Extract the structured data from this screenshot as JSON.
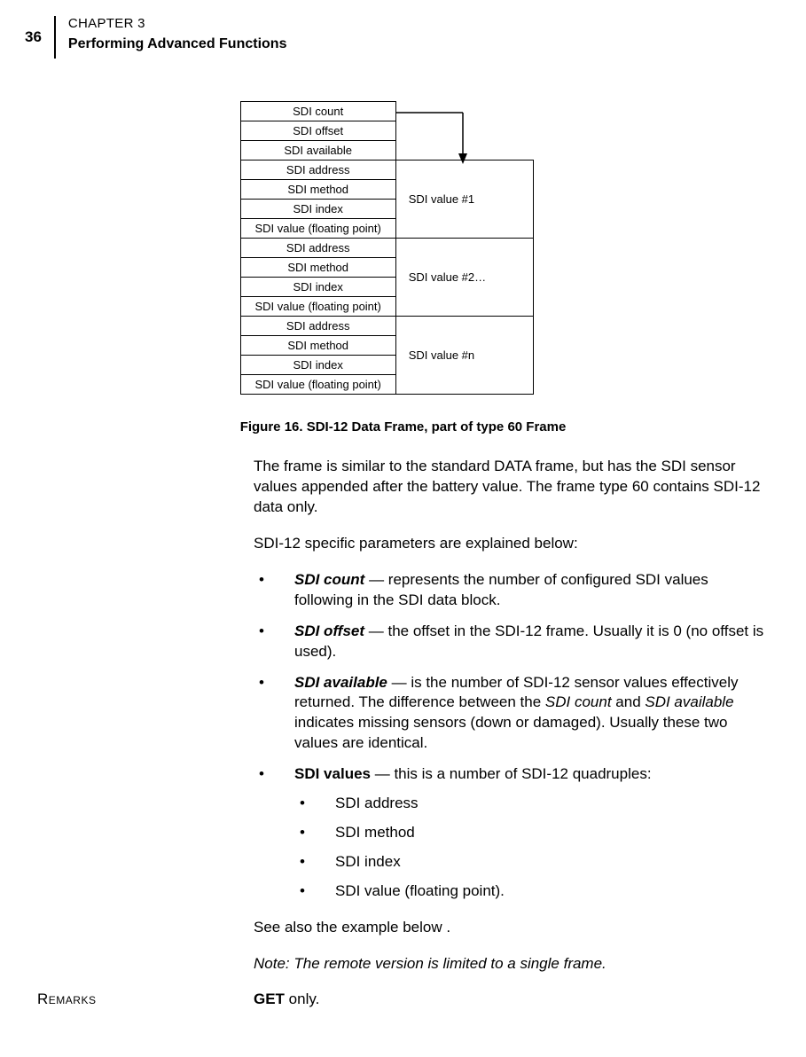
{
  "header": {
    "page_number": "36",
    "chapter_label": "CHAPTER 3",
    "section_title": "Performing Advanced Functions"
  },
  "figure": {
    "header_rows": [
      "SDI count",
      "SDI offset",
      "SDI available"
    ],
    "value_blocks": [
      {
        "label": "SDI value #1",
        "rows": [
          "SDI address",
          "SDI method",
          "SDI index",
          "SDI value (floating point)"
        ]
      },
      {
        "label": "SDI value #2…",
        "rows": [
          "SDI address",
          "SDI method",
          "SDI index",
          "SDI value (floating point)"
        ]
      },
      {
        "label": "SDI value #n",
        "rows": [
          "SDI address",
          "SDI method",
          "SDI index",
          "SDI value (floating point)"
        ]
      }
    ],
    "caption": "Figure 16.  SDI-12 Data Frame, part of type 60 Frame"
  },
  "body": {
    "para1": "The frame is similar to the standard DATA frame, but has the SDI sensor values appended after the battery value. The frame type 60 contains SDI-12 data only.",
    "para2": "SDI-12 specific parameters are explained below:",
    "bullets": [
      {
        "label": "SDI count",
        "text": " — represents the number of configured SDI values following in the SDI data block."
      },
      {
        "label": "SDI offset",
        "text": " — the offset in the SDI-12 frame. Usually it is 0 (no offset is used)."
      },
      {
        "label": "SDI available",
        "text_pre": " — is the number of SDI-12 sensor values effectively returned. The difference between the ",
        "i1": "SDI count",
        "text_mid": " and ",
        "i2": "SDI available",
        "text_post": " indicates missing sensors (down or damaged). Usually these two values are identical."
      },
      {
        "label": "SDI values",
        "text": " — this is a number of SDI-12 quadruples:"
      }
    ],
    "sub_bullets": [
      "SDI address",
      "SDI method",
      "SDI index",
      "SDI value (floating point)."
    ],
    "para3": "See also the example below .",
    "note": "Note: The remote version is limited to a single frame.",
    "remarks_label": "Remarks",
    "remarks_bold": "GET",
    "remarks_text": " only."
  }
}
